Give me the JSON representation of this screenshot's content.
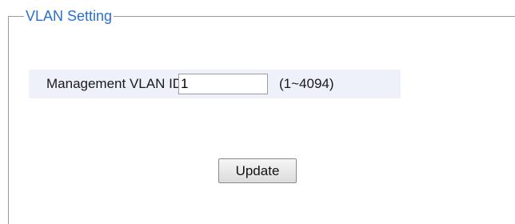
{
  "section": {
    "legend": "VLAN Setting"
  },
  "management_vlan": {
    "label": "Management VLAN ID",
    "value": "1",
    "range_hint": "(1~4094)"
  },
  "actions": {
    "update_label": "Update"
  },
  "colors": {
    "legend_text": "#2a6fd3",
    "row_background": "#eef0fa",
    "fieldset_border": "#9a9a9a"
  }
}
